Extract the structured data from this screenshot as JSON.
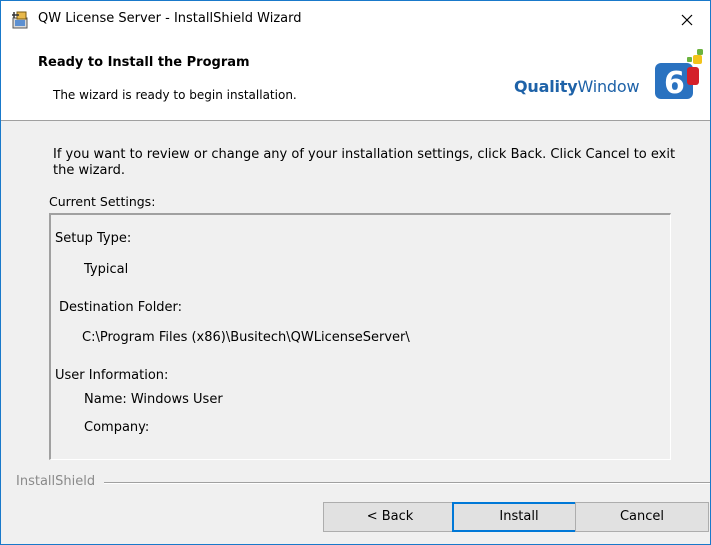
{
  "window": {
    "title": "QW License Server - InstallShield Wizard",
    "close_glyph": "✕"
  },
  "header": {
    "title": "Ready to Install the Program",
    "subtitle": "The wizard is ready to begin installation.",
    "brand_bold": "Quality",
    "brand_regular": "Window",
    "logo_number": "6"
  },
  "main": {
    "instructions": "If you want to review or change any of your installation settings, click Back. Click Cancel to exit the wizard.",
    "current_settings_label": "Current Settings:",
    "settings": {
      "setup_type_label": "Setup Type:",
      "setup_type_value": "Typical",
      "destination_label": "Destination Folder:",
      "destination_value": "C:\\Program Files (x86)\\Busitech\\QWLicenseServer\\",
      "user_info_label": "User Information:",
      "name_line": "Name: Windows User",
      "company_line": "Company:"
    }
  },
  "footer": {
    "installshield_label": "InstallShield",
    "back_label": "< Back",
    "install_label": "Install",
    "cancel_label": "Cancel"
  },
  "colors": {
    "brand_blue": "#1e62a8",
    "logo_blue": "#2a72c0",
    "default_button_border": "#0078d7"
  }
}
